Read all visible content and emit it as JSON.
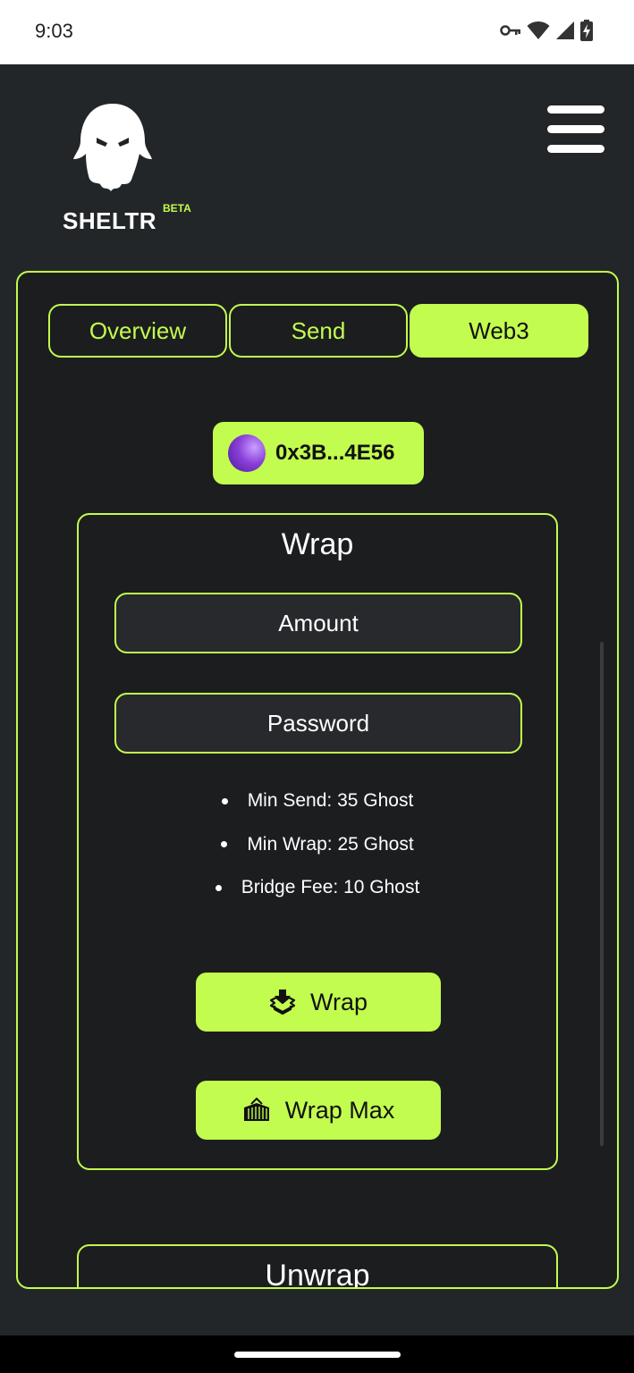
{
  "status_bar": {
    "time": "9:03",
    "icons": [
      "key-icon",
      "wifi-icon",
      "signal-icon",
      "battery-charging-icon"
    ]
  },
  "header": {
    "logo_icon": "ghost-icon",
    "logo_text": "SHELTR",
    "logo_badge": "BETA",
    "menu_icon": "hamburger-menu-icon"
  },
  "tabs": [
    {
      "label": "Overview",
      "active": false
    },
    {
      "label": "Send",
      "active": false
    },
    {
      "label": "Web3",
      "active": true
    }
  ],
  "wallet": {
    "address": "0x3B...4E56"
  },
  "wrap_card": {
    "title": "Wrap",
    "amount_placeholder": "Amount",
    "password_placeholder": "Password",
    "info": [
      "Min Send: 35 Ghost",
      "Min Wrap: 25 Ghost",
      "Bridge Fee: 10 Ghost"
    ],
    "wrap_button": "Wrap",
    "wrap_max_button": "Wrap Max"
  },
  "unwrap_card": {
    "title": "Unwrap"
  },
  "colors": {
    "accent": "#c2fc4e",
    "background": "#232628",
    "panel": "#1c1d1f"
  }
}
